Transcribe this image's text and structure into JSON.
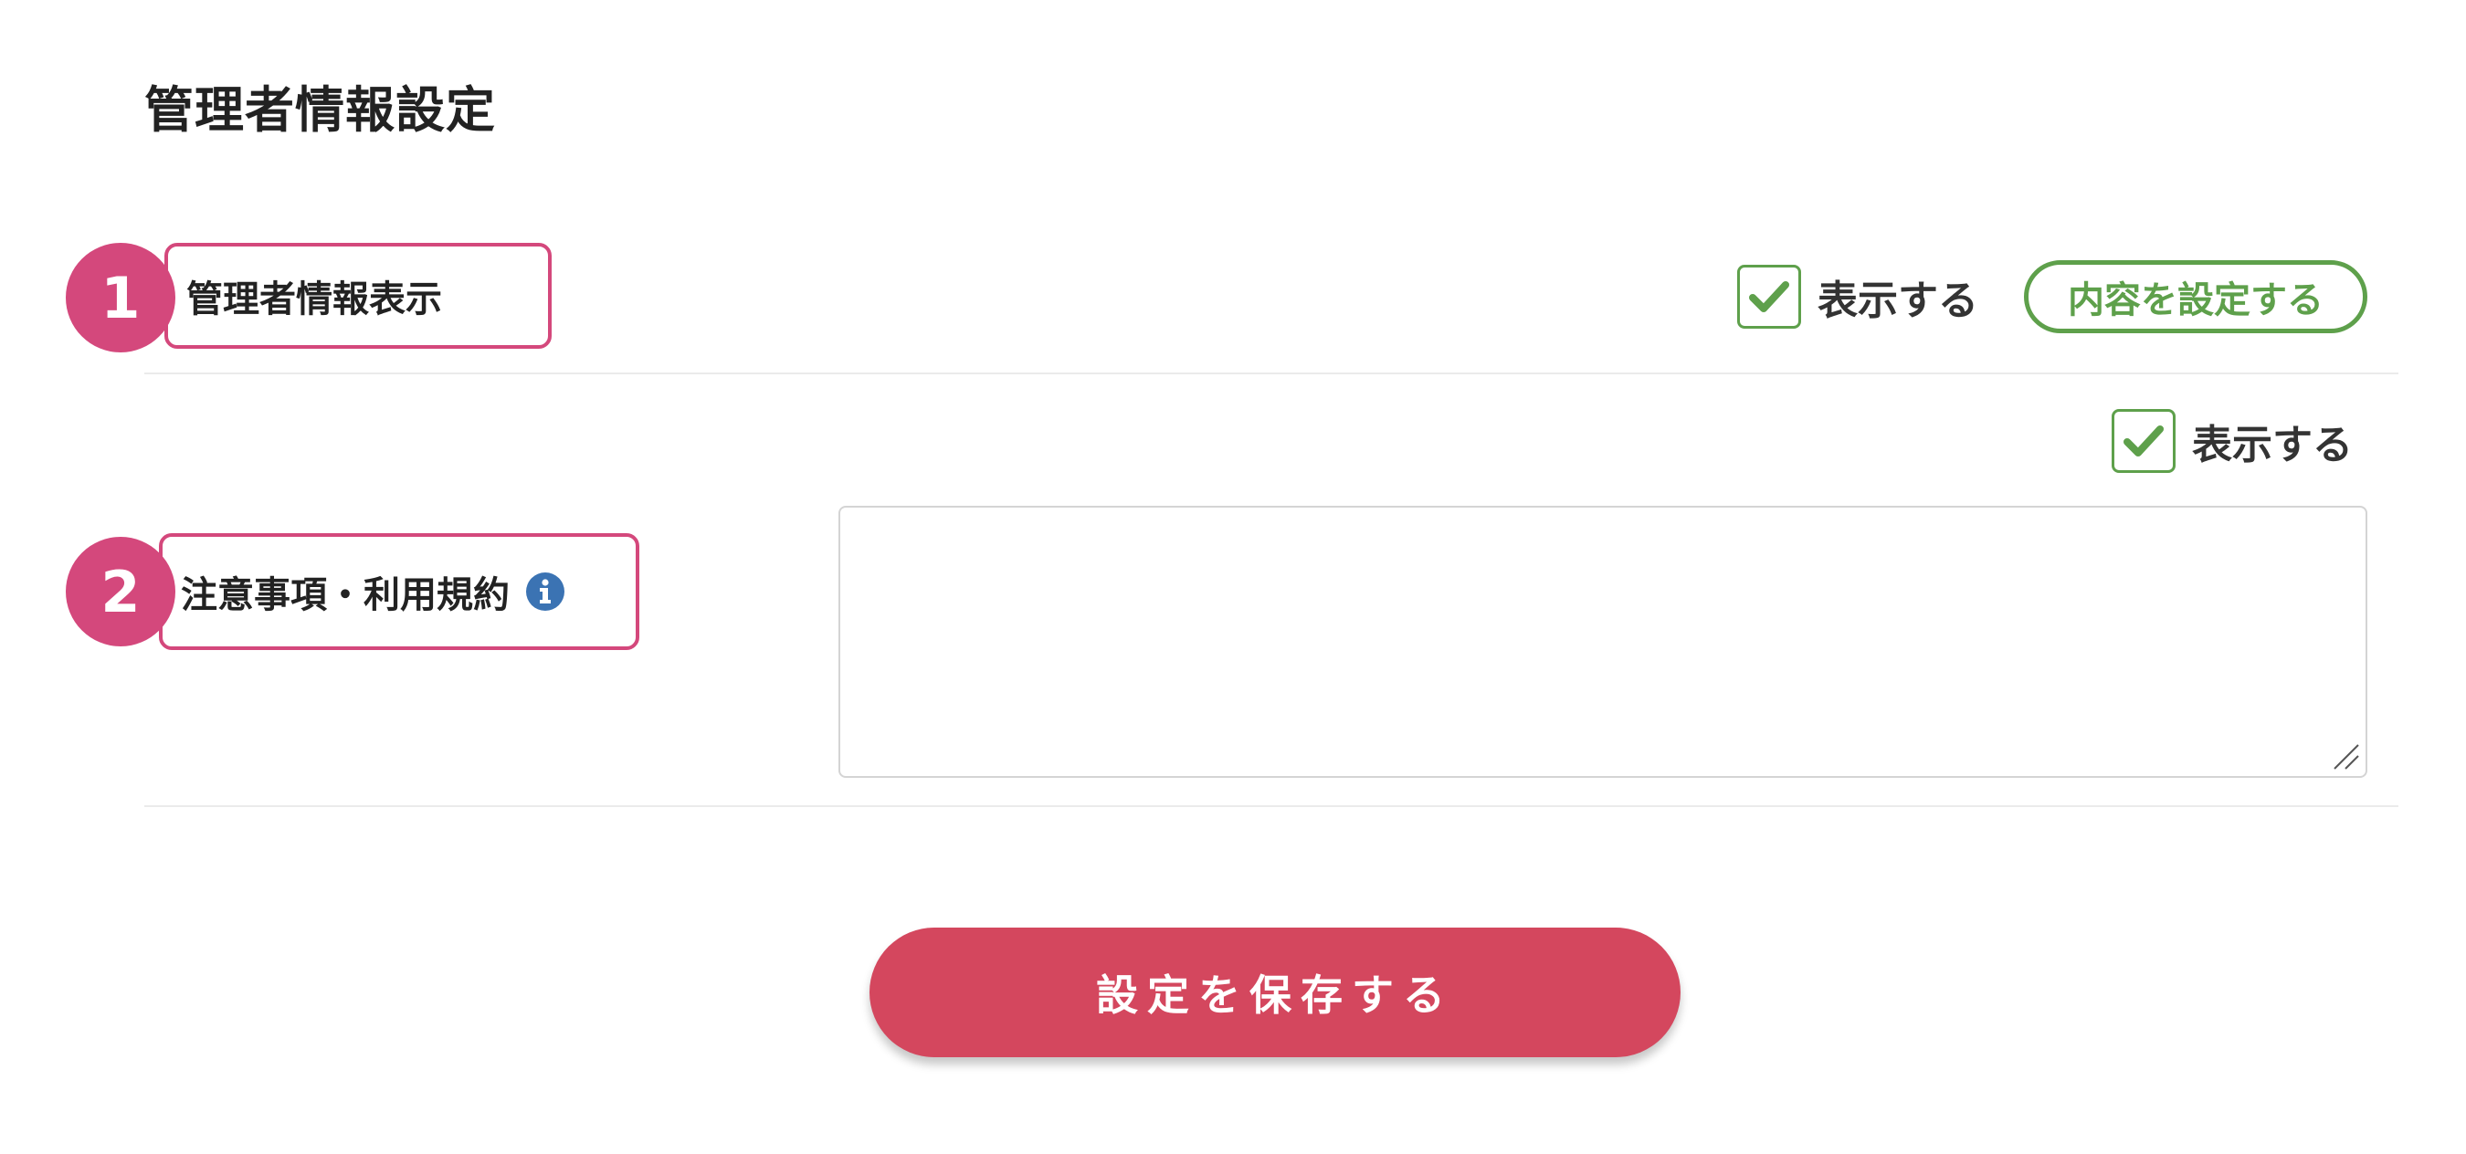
{
  "page": {
    "title": "管理者情報設定"
  },
  "colors": {
    "marker": "#d4487c",
    "accent_green": "#5ea04b",
    "info_blue": "#3b73b3",
    "save_button": "#d4475e"
  },
  "sections": [
    {
      "marker": "1",
      "label": "管理者情報表示",
      "show_checkbox": {
        "label": "表示する",
        "checked": true
      },
      "configure_button": "内容を設定する"
    },
    {
      "marker": "2",
      "label": "注意事項・利用規約",
      "info_icon": "info-icon",
      "show_checkbox": {
        "label": "表示する",
        "checked": true
      },
      "textarea": {
        "value": "",
        "placeholder": ""
      }
    }
  ],
  "footer": {
    "save_label": "設定を保存する"
  }
}
